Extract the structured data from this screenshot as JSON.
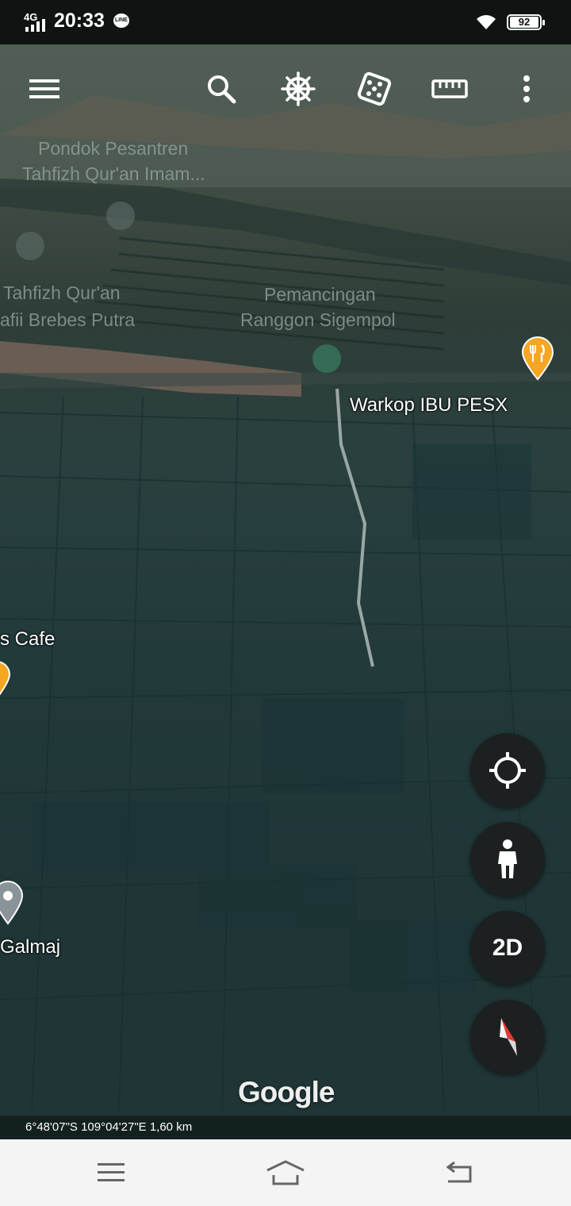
{
  "status_bar": {
    "network": "4G",
    "time": "20:33",
    "line_badge": "LINE",
    "battery": "92"
  },
  "toolbar": {
    "menu_icon": "hamburger-menu-icon",
    "search_icon": "search-icon",
    "voyager_icon": "ship-wheel-icon",
    "feeling_lucky_icon": "dice-icon",
    "measure_icon": "ruler-icon",
    "more_icon": "more-vertical-icon"
  },
  "map_labels": {
    "pondok_line1": "Pondok Pesantren",
    "pondok_line2": "Tahfizh Qur'an Imam...",
    "tahfizh_line1": "Tahfizh Qur'an",
    "tahfizh_line2": "afii Brebes Putra",
    "pemancingan_line1": "Pemancingan",
    "pemancingan_line2": "Ranggon Sigempol",
    "warkop": "Warkop IBU PESX",
    "cafe": "s Cafe",
    "galmaj": "Galmaj"
  },
  "controls": {
    "locate_icon": "crosshair-location-icon",
    "street_view_icon": "pegman-icon",
    "view_mode": "2D",
    "compass_icon": "compass-needle-icon"
  },
  "attribution": "Google",
  "coordinates": "6°48'07\"S 109°04'27\"E 1,60 km",
  "nav_bar": {
    "menu_icon": "nav-menu-icon",
    "home_icon": "nav-home-icon",
    "back_icon": "nav-back-icon"
  },
  "colors": {
    "poi_restaurant": "#f5a623",
    "compass_red": "#e53935"
  }
}
